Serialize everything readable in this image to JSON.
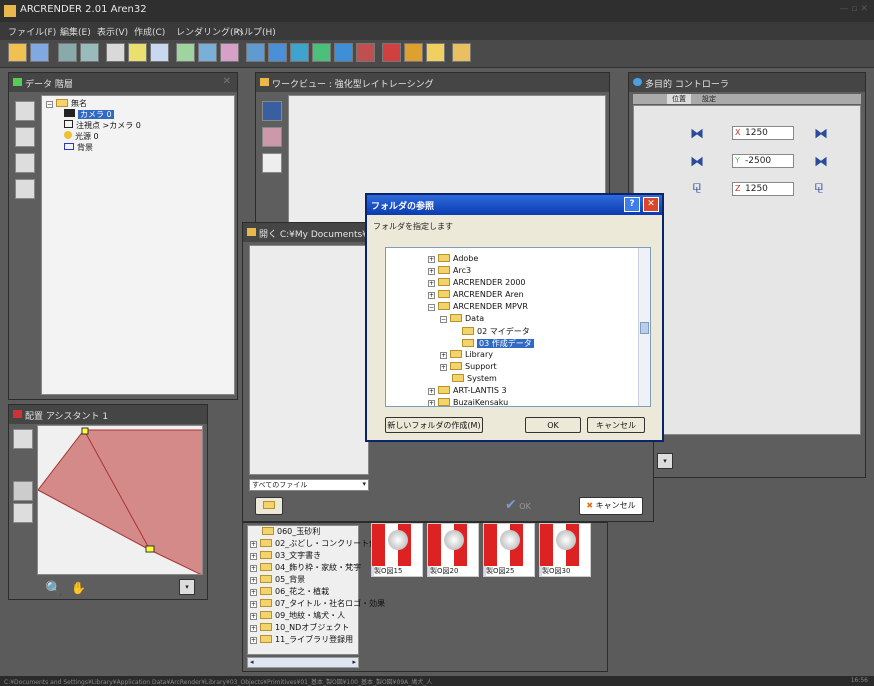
{
  "app": {
    "title": "ARCRENDER 2.01 Aren32"
  },
  "menu": [
    "ファイル(F)",
    "編集(E)",
    "表示(V)",
    "作成(C)",
    "レンダリング(R)",
    "ヘルプ(H)"
  ],
  "data_panel": {
    "title": "データ 階層",
    "root": "無名",
    "items": [
      "カメラ 0",
      "注視点 >カメラ 0",
      "光源 0",
      "背景"
    ]
  },
  "workview": {
    "title": "ワークビュー : 強化型レイトレーシング"
  },
  "controller": {
    "title": "多目的 コントローラ",
    "tabs": [
      "位置",
      "設定"
    ],
    "x_label": "X",
    "x_value": "1250",
    "y_label": "Y",
    "y_value": "-2500",
    "z_label": "Z",
    "z_value": "1250"
  },
  "open_dialog": {
    "title": "開く C:¥My Documents¥My",
    "filter": "すべてのファイル",
    "ok": "OK",
    "cancel": "キャンセル"
  },
  "folder_dialog": {
    "title": "フォルダの参照",
    "help": "?",
    "prompt": "フォルダを指定します",
    "tree": [
      {
        "label": "Adobe",
        "expander": "+"
      },
      {
        "label": "Arc3",
        "expander": "+"
      },
      {
        "label": "ARCRENDER 2000",
        "expander": "+"
      },
      {
        "label": "ARCRENDER Aren",
        "expander": "+"
      },
      {
        "label": "ARCRENDER MPVR",
        "expander": "−"
      },
      {
        "label": "Data",
        "expander": "−"
      },
      {
        "label": "02 マイデータ",
        "expander": ""
      },
      {
        "label": "03 作成データ",
        "expander": "",
        "selected": true
      },
      {
        "label": "Library",
        "expander": "+"
      },
      {
        "label": "Support",
        "expander": "+"
      },
      {
        "label": "System",
        "expander": ""
      },
      {
        "label": "ART-LANTIS 3",
        "expander": "+"
      },
      {
        "label": "BuzaiKensaku",
        "expander": "+"
      }
    ],
    "new_folder": "新しいフォルダの作成(M)",
    "ok": "OK",
    "cancel": "キャンセル"
  },
  "assistant": {
    "title": "配置 アシスタント 1"
  },
  "library": {
    "folders": [
      "060_玉砂利",
      "02_ぶどし・コンクリート他",
      "03_文字書き",
      "04_飾り枠・家紋・梵字",
      "05_背景",
      "06_花之・植栽",
      "07_タイトル・社名ロゴ・効果",
      "09_地紋・鳩犬・人",
      "10_NDオブジェクト",
      "11_ライブラリ登録用"
    ],
    "thumbs": [
      "製O図15",
      "製O図20",
      "製O図25",
      "製O図30"
    ]
  },
  "statusbar": {
    "text": "C:¥Documents and Settings¥Library¥Application Data¥ArcRender¥Library¥03_Objects¥Primitives¥01_基本_製O図¥100_基本_製O図¥09A_鳩犬_人",
    "time": "16:56"
  },
  "colors": {
    "accent": "#0a246a",
    "dialog_face": "#ece9d8",
    "selection": "#316ac5",
    "panel": "#5e5e5e"
  }
}
